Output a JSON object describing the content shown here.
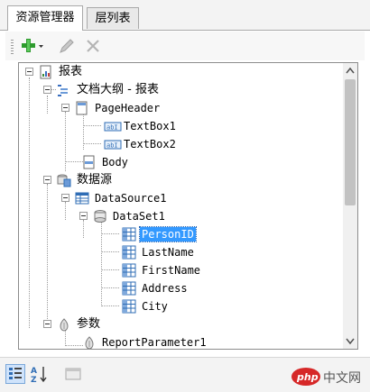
{
  "tabs": [
    {
      "label": "资源管理器",
      "active": true
    },
    {
      "label": "层列表",
      "active": false
    }
  ],
  "tree": [
    {
      "label": "报表",
      "icon": "report-icon",
      "mono": false
    },
    {
      "label": "文档大纲 - 报表",
      "icon": "outline-icon",
      "mono": false
    },
    {
      "label": "PageHeader",
      "icon": "page-icon",
      "mono": true
    },
    {
      "label": "TextBox1",
      "icon": "textbox-icon",
      "mono": true
    },
    {
      "label": "TextBox2",
      "icon": "textbox-icon",
      "mono": true
    },
    {
      "label": "Body",
      "icon": "page-icon",
      "mono": true
    },
    {
      "label": "数据源",
      "icon": "datasources-icon",
      "mono": false
    },
    {
      "label": "DataSource1",
      "icon": "datasource-icon",
      "mono": true
    },
    {
      "label": "DataSet1",
      "icon": "dataset-icon",
      "mono": true
    },
    {
      "label": "PersonID",
      "icon": "field-icon",
      "mono": true,
      "selected": true
    },
    {
      "label": "LastName",
      "icon": "field-icon",
      "mono": true
    },
    {
      "label": "FirstName",
      "icon": "field-icon",
      "mono": true
    },
    {
      "label": "Address",
      "icon": "field-icon",
      "mono": true
    },
    {
      "label": "City",
      "icon": "field-icon",
      "mono": true
    },
    {
      "label": "参数",
      "icon": "parameters-icon",
      "mono": false
    },
    {
      "label": "ReportParameter1",
      "icon": "parameter-icon",
      "mono": true
    }
  ],
  "watermark": {
    "brand": "php",
    "text": "中文网"
  },
  "colors": {
    "selection": "#3399ff",
    "add": "#2e9b2e",
    "field_icon": "#2f6db5"
  }
}
